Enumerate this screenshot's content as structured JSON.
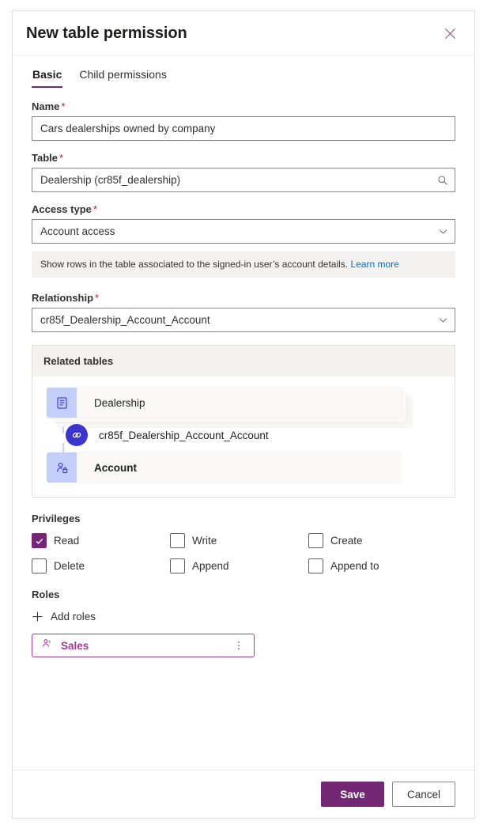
{
  "header": {
    "title": "New table permission",
    "close_icon": "close-icon"
  },
  "tabs": [
    {
      "label": "Basic",
      "active": true
    },
    {
      "label": "Child permissions",
      "active": false
    }
  ],
  "form": {
    "name": {
      "label": "Name",
      "required_marker": "*",
      "value": "Cars dealerships owned by company"
    },
    "table": {
      "label": "Table",
      "required_marker": "*",
      "value": "Dealership (cr85f_dealership)",
      "affix_icon": "search-icon"
    },
    "access_type": {
      "label": "Access type",
      "required_marker": "*",
      "value": "Account access",
      "affix_icon": "chevron-down-icon",
      "hint_text": "Show rows in the table associated to the signed-in user’s account details.",
      "hint_link": "Learn more"
    },
    "relationship": {
      "label": "Relationship",
      "required_marker": "*",
      "value": "cr85f_Dealership_Account_Account",
      "affix_icon": "chevron-down-icon"
    }
  },
  "related_tables": {
    "title": "Related tables",
    "source": {
      "name": "Dealership",
      "icon": "table-rows-icon",
      "stacked": true
    },
    "relationship": {
      "name": "cr85f_Dealership_Account_Account",
      "icon": "link-chain-icon"
    },
    "target": {
      "name": "Account",
      "icon": "account-person-icon",
      "stacked": false
    }
  },
  "privileges": {
    "label": "Privileges",
    "items": [
      {
        "label": "Read",
        "checked": true
      },
      {
        "label": "Write",
        "checked": false
      },
      {
        "label": "Create",
        "checked": false
      },
      {
        "label": "Delete",
        "checked": false
      },
      {
        "label": "Append",
        "checked": false
      },
      {
        "label": "Append to",
        "checked": false
      }
    ]
  },
  "roles": {
    "label": "Roles",
    "add_label": "Add roles",
    "add_icon": "plus-icon",
    "chips": [
      {
        "name": "Sales",
        "icon": "role-person-icon",
        "menu_icon": "more-vertical-icon"
      }
    ]
  },
  "footer": {
    "save_label": "Save",
    "cancel_label": "Cancel"
  },
  "colors": {
    "accent_purple": "#742774",
    "chip_purple": "#a4379a",
    "link_blue": "#0f6cbd",
    "node_indigo": "#3B35CF",
    "tile_lavender": "#c3cffa",
    "required_red": "#a4262c",
    "hint_bg": "#f3f2f1"
  }
}
